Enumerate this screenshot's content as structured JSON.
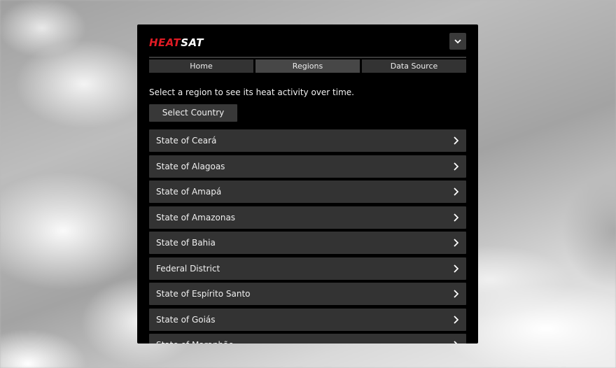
{
  "app": {
    "logo_heat": "HEAT",
    "logo_sat": "SAT"
  },
  "nav": {
    "tabs": [
      {
        "label": "Home"
      },
      {
        "label": "Regions"
      },
      {
        "label": "Data Source"
      }
    ],
    "active_tab": "Regions"
  },
  "main": {
    "intro": "Select a region to see its heat activity over time.",
    "select_country_label": "Select Country",
    "regions": [
      {
        "label": "State of Ceará"
      },
      {
        "label": "State of Alagoas"
      },
      {
        "label": "State of Amapá"
      },
      {
        "label": "State of Amazonas"
      },
      {
        "label": "State of Bahia"
      },
      {
        "label": "Federal District"
      },
      {
        "label": "State of Espírito Santo"
      },
      {
        "label": "State of Goiás"
      },
      {
        "label": "State of Maranhão"
      }
    ]
  },
  "icons": {
    "menu_toggle": "chevron-down-icon",
    "region_arrow": "chevron-right-icon"
  },
  "colors": {
    "brand_red": "#e01b24",
    "panel_bg": "#000000",
    "item_bg": "#333333"
  }
}
